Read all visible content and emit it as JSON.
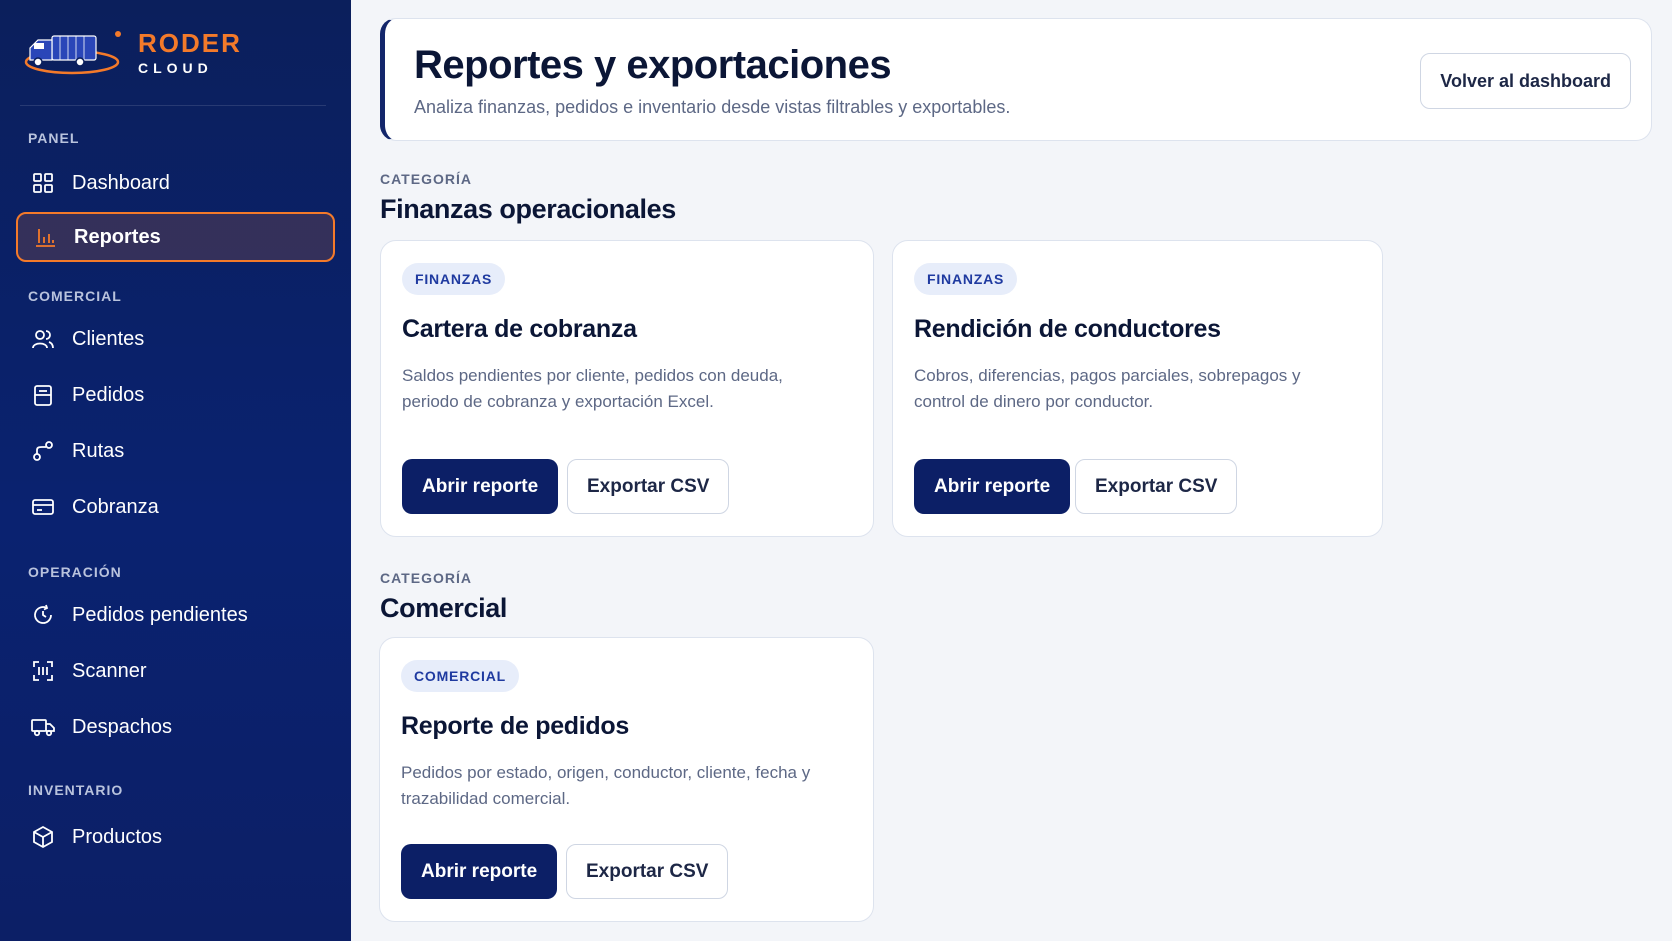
{
  "brand": {
    "name": "RODER",
    "sub": "CLOUD"
  },
  "sidebar": {
    "sections": [
      {
        "label": "PANEL",
        "items": [
          {
            "label": "Dashboard",
            "icon": "grid-icon",
            "active": false
          },
          {
            "label": "Reportes",
            "icon": "bar-chart-icon",
            "active": true
          }
        ]
      },
      {
        "label": "COMERCIAL",
        "items": [
          {
            "label": "Clientes",
            "icon": "users-icon",
            "active": false
          },
          {
            "label": "Pedidos",
            "icon": "clipboard-icon",
            "active": false
          },
          {
            "label": "Rutas",
            "icon": "route-icon",
            "active": false
          },
          {
            "label": "Cobranza",
            "icon": "card-icon",
            "active": false
          }
        ]
      },
      {
        "label": "OPERACIÓN",
        "items": [
          {
            "label": "Pedidos pendientes",
            "icon": "refresh-clock-icon",
            "active": false
          },
          {
            "label": "Scanner",
            "icon": "scan-icon",
            "active": false
          },
          {
            "label": "Despachos",
            "icon": "truck-icon",
            "active": false
          }
        ]
      },
      {
        "label": "INVENTARIO",
        "items": [
          {
            "label": "Productos",
            "icon": "box-icon",
            "active": false
          }
        ]
      }
    ]
  },
  "header": {
    "title": "Reportes y exportaciones",
    "subtitle": "Analiza finanzas, pedidos e inventario desde vistas filtrables y exportables.",
    "back_button": "Volver al dashboard"
  },
  "categories": [
    {
      "label": "CATEGORÍA",
      "title": "Finanzas operacionales",
      "cards": [
        {
          "badge": "FINANZAS",
          "title": "Cartera de cobranza",
          "description": "Saldos pendientes por cliente, pedidos con deuda, periodo de cobranza y exportación Excel.",
          "open_label": "Abrir reporte",
          "export_label": "Exportar CSV"
        },
        {
          "badge": "FINANZAS",
          "title": "Rendición de conductores",
          "description": "Cobros, diferencias, pagos parciales, sobrepagos y control de dinero por conductor.",
          "open_label": "Abrir reporte",
          "export_label": "Exportar CSV"
        }
      ]
    },
    {
      "label": "CATEGORÍA",
      "title": "Comercial",
      "cards": [
        {
          "badge": "COMERCIAL",
          "title": "Reporte de pedidos",
          "description": "Pedidos por estado, origen, conductor, cliente, fecha y trazabilidad comercial.",
          "open_label": "Abrir reporte",
          "export_label": "Exportar CSV"
        }
      ]
    }
  ],
  "colors": {
    "accent": "#f47a2a",
    "primary": "#0c1f66",
    "badge_bg": "#e7edfa"
  }
}
